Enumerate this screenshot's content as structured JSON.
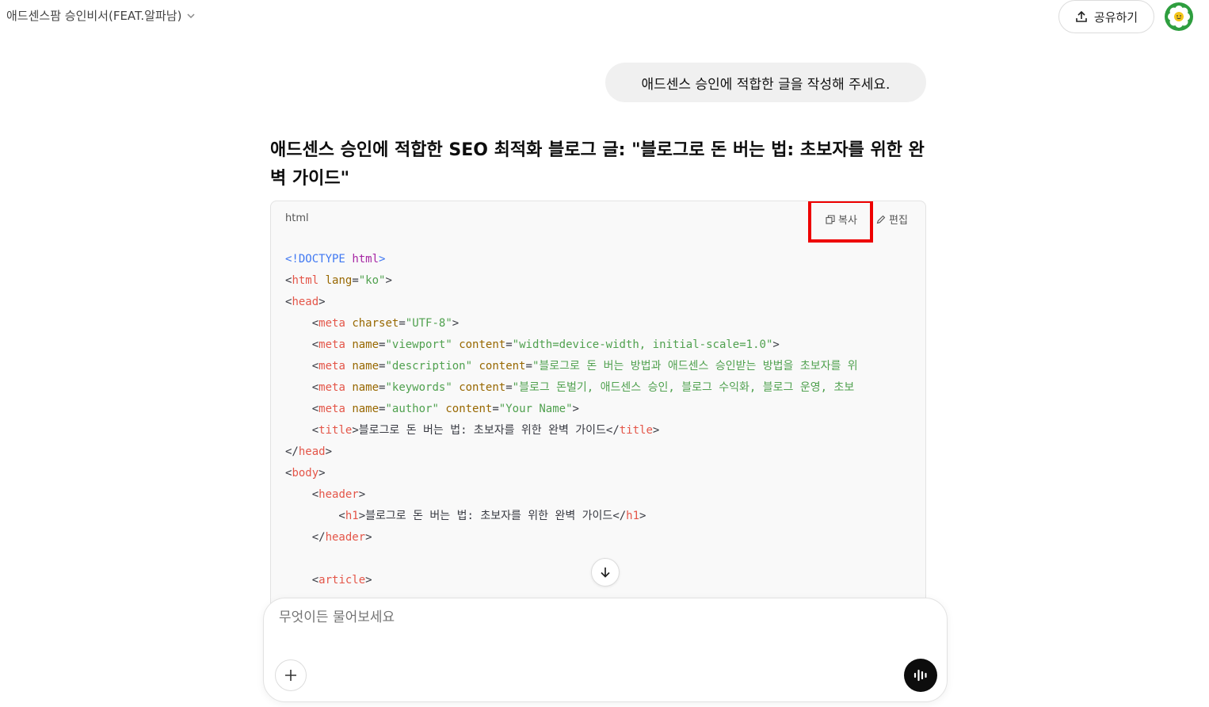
{
  "header": {
    "title": "애드센스팜 승인비서(FEAT.알파남)",
    "share_label": "공유하기"
  },
  "conversation": {
    "user_message": "애드센스 승인에 적합한 글을 작성해 주세요.",
    "answer_title": "애드센스 승인에 적합한 SEO 최적화 블로그 글: \"블로그로 돈 버는 법: 초보자를 위한 완벽 가이드\"",
    "code_block": {
      "language": "html",
      "copy_label": "복사",
      "edit_label": "편집",
      "lines": [
        [
          {
            "t": "<!",
            "c": "doc"
          },
          {
            "t": "DOCTYPE",
            "c": "doc"
          },
          {
            "t": " ",
            "c": "text"
          },
          {
            "t": "html",
            "c": "kw"
          },
          {
            "t": ">",
            "c": "doc"
          }
        ],
        [
          {
            "t": "<",
            "c": "punc"
          },
          {
            "t": "html",
            "c": "tag"
          },
          {
            "t": " ",
            "c": "text"
          },
          {
            "t": "lang",
            "c": "attr"
          },
          {
            "t": "=",
            "c": "punc"
          },
          {
            "t": "\"ko\"",
            "c": "val"
          },
          {
            "t": ">",
            "c": "punc"
          }
        ],
        [
          {
            "t": "<",
            "c": "punc"
          },
          {
            "t": "head",
            "c": "tag"
          },
          {
            "t": ">",
            "c": "punc"
          }
        ],
        [
          {
            "t": "    <",
            "c": "punc"
          },
          {
            "t": "meta",
            "c": "tag"
          },
          {
            "t": " ",
            "c": "text"
          },
          {
            "t": "charset",
            "c": "attr"
          },
          {
            "t": "=",
            "c": "punc"
          },
          {
            "t": "\"UTF-8\"",
            "c": "val"
          },
          {
            "t": ">",
            "c": "punc"
          }
        ],
        [
          {
            "t": "    <",
            "c": "punc"
          },
          {
            "t": "meta",
            "c": "tag"
          },
          {
            "t": " ",
            "c": "text"
          },
          {
            "t": "name",
            "c": "attr"
          },
          {
            "t": "=",
            "c": "punc"
          },
          {
            "t": "\"viewport\"",
            "c": "val"
          },
          {
            "t": " ",
            "c": "text"
          },
          {
            "t": "content",
            "c": "attr"
          },
          {
            "t": "=",
            "c": "punc"
          },
          {
            "t": "\"width=device-width, initial-scale=1.0\"",
            "c": "val"
          },
          {
            "t": ">",
            "c": "punc"
          }
        ],
        [
          {
            "t": "    <",
            "c": "punc"
          },
          {
            "t": "meta",
            "c": "tag"
          },
          {
            "t": " ",
            "c": "text"
          },
          {
            "t": "name",
            "c": "attr"
          },
          {
            "t": "=",
            "c": "punc"
          },
          {
            "t": "\"description\"",
            "c": "val"
          },
          {
            "t": " ",
            "c": "text"
          },
          {
            "t": "content",
            "c": "attr"
          },
          {
            "t": "=",
            "c": "punc"
          },
          {
            "t": "\"블로그로 돈 버는 방법과 애드센스 승인받는 방법을 초보자를 위",
            "c": "val"
          }
        ],
        [
          {
            "t": "    <",
            "c": "punc"
          },
          {
            "t": "meta",
            "c": "tag"
          },
          {
            "t": " ",
            "c": "text"
          },
          {
            "t": "name",
            "c": "attr"
          },
          {
            "t": "=",
            "c": "punc"
          },
          {
            "t": "\"keywords\"",
            "c": "val"
          },
          {
            "t": " ",
            "c": "text"
          },
          {
            "t": "content",
            "c": "attr"
          },
          {
            "t": "=",
            "c": "punc"
          },
          {
            "t": "\"블로그 돈벌기, 애드센스 승인, 블로그 수익화, 블로그 운영, 초보",
            "c": "val"
          }
        ],
        [
          {
            "t": "    <",
            "c": "punc"
          },
          {
            "t": "meta",
            "c": "tag"
          },
          {
            "t": " ",
            "c": "text"
          },
          {
            "t": "name",
            "c": "attr"
          },
          {
            "t": "=",
            "c": "punc"
          },
          {
            "t": "\"author\"",
            "c": "val"
          },
          {
            "t": " ",
            "c": "text"
          },
          {
            "t": "content",
            "c": "attr"
          },
          {
            "t": "=",
            "c": "punc"
          },
          {
            "t": "\"Your Name\"",
            "c": "val"
          },
          {
            "t": ">",
            "c": "punc"
          }
        ],
        [
          {
            "t": "    <",
            "c": "punc"
          },
          {
            "t": "title",
            "c": "tag"
          },
          {
            "t": ">",
            "c": "punc"
          },
          {
            "t": "블로그로 돈 버는 법: 초보자를 위한 완벽 가이드",
            "c": "text"
          },
          {
            "t": "</",
            "c": "punc"
          },
          {
            "t": "title",
            "c": "tag"
          },
          {
            "t": ">",
            "c": "punc"
          }
        ],
        [
          {
            "t": "</",
            "c": "punc"
          },
          {
            "t": "head",
            "c": "tag"
          },
          {
            "t": ">",
            "c": "punc"
          }
        ],
        [
          {
            "t": "<",
            "c": "punc"
          },
          {
            "t": "body",
            "c": "tag"
          },
          {
            "t": ">",
            "c": "punc"
          }
        ],
        [
          {
            "t": "    <",
            "c": "punc"
          },
          {
            "t": "header",
            "c": "tag"
          },
          {
            "t": ">",
            "c": "punc"
          }
        ],
        [
          {
            "t": "        <",
            "c": "punc"
          },
          {
            "t": "h1",
            "c": "tag"
          },
          {
            "t": ">",
            "c": "punc"
          },
          {
            "t": "블로그로 돈 버는 법: 초보자를 위한 완벽 가이드",
            "c": "text"
          },
          {
            "t": "</",
            "c": "punc"
          },
          {
            "t": "h1",
            "c": "tag"
          },
          {
            "t": ">",
            "c": "punc"
          }
        ],
        [
          {
            "t": "    </",
            "c": "punc"
          },
          {
            "t": "header",
            "c": "tag"
          },
          {
            "t": ">",
            "c": "punc"
          }
        ],
        [],
        [
          {
            "t": "    <",
            "c": "punc"
          },
          {
            "t": "article",
            "c": "tag"
          },
          {
            "t": ">",
            "c": "punc"
          }
        ]
      ]
    }
  },
  "composer": {
    "placeholder": "무엇이든 물어보세요"
  },
  "colors": {
    "highlight": "#ee0000",
    "tag": "#e45649",
    "attr": "#986801",
    "value": "#50a14f",
    "doctype": "#4078f2"
  },
  "icons": {
    "model_chevron": "chevron-down-icon",
    "share": "upload-icon",
    "avatar": "flower-avatar-icon",
    "copy": "copy-icon",
    "edit": "pen-icon",
    "scroll": "arrow-down-icon",
    "plus": "plus-icon",
    "voice": "voice-wave-icon"
  }
}
